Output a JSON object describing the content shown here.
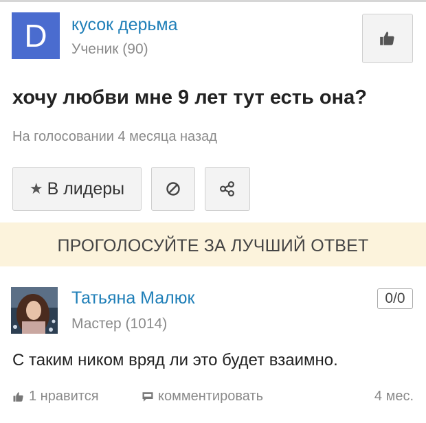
{
  "question_author": {
    "avatar_letter": "D",
    "name": "кусок дерьма",
    "rank": "Ученик (90)"
  },
  "question": {
    "title": "хочу любви мне 9 лет тут есть она?",
    "status": "На голосовании 4 месяца назад"
  },
  "actions": {
    "leaders_label": "В лидеры"
  },
  "vote_banner": "ПРОГОЛОСУЙТЕ ЗА ЛУЧШИЙ ОТВЕТ",
  "answer": {
    "author_name": "Татьяна Малюк",
    "author_rank": "Мастер (1014)",
    "score": "0/0",
    "text": "С таким ником вряд ли это будет взаимно.",
    "likes": "1 нравится",
    "comment_label": "комментировать",
    "time": "4 мес."
  },
  "icons": {
    "like": "thumbs-up-icon",
    "star": "star-icon",
    "block": "block-icon",
    "share": "share-icon",
    "comment": "comment-icon"
  },
  "colors": {
    "link": "#1f7fb8",
    "avatar": "#4a6ccf",
    "banner": "#fcf3dc",
    "muted": "#8a8a8a"
  }
}
